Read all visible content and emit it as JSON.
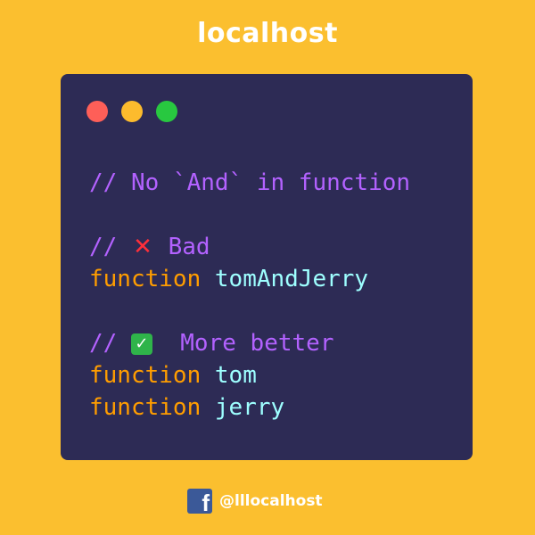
{
  "header": {
    "title": "localhost"
  },
  "window": {
    "controls": [
      "close",
      "minimize",
      "maximize"
    ]
  },
  "code": {
    "line1": "// No `And` in function",
    "bad_comment_prefix": "// ",
    "bad_mark": "❌",
    "bad_label": "Bad",
    "bad_keyword": "function",
    "bad_name": "tomAndJerry",
    "good_comment_prefix": "// ",
    "good_mark": "✅",
    "good_label": "More better",
    "good_keyword_1": "function",
    "good_name_1": "tom",
    "good_keyword_2": "function",
    "good_name_2": "jerry"
  },
  "footer": {
    "icon": "facebook-icon",
    "handle": "@lllocalhost"
  },
  "colors": {
    "background": "#fbbf2f",
    "window": "#2d2b55",
    "comment": "#b362ff",
    "keyword": "#ff9d00",
    "identifier": "#9effff"
  }
}
